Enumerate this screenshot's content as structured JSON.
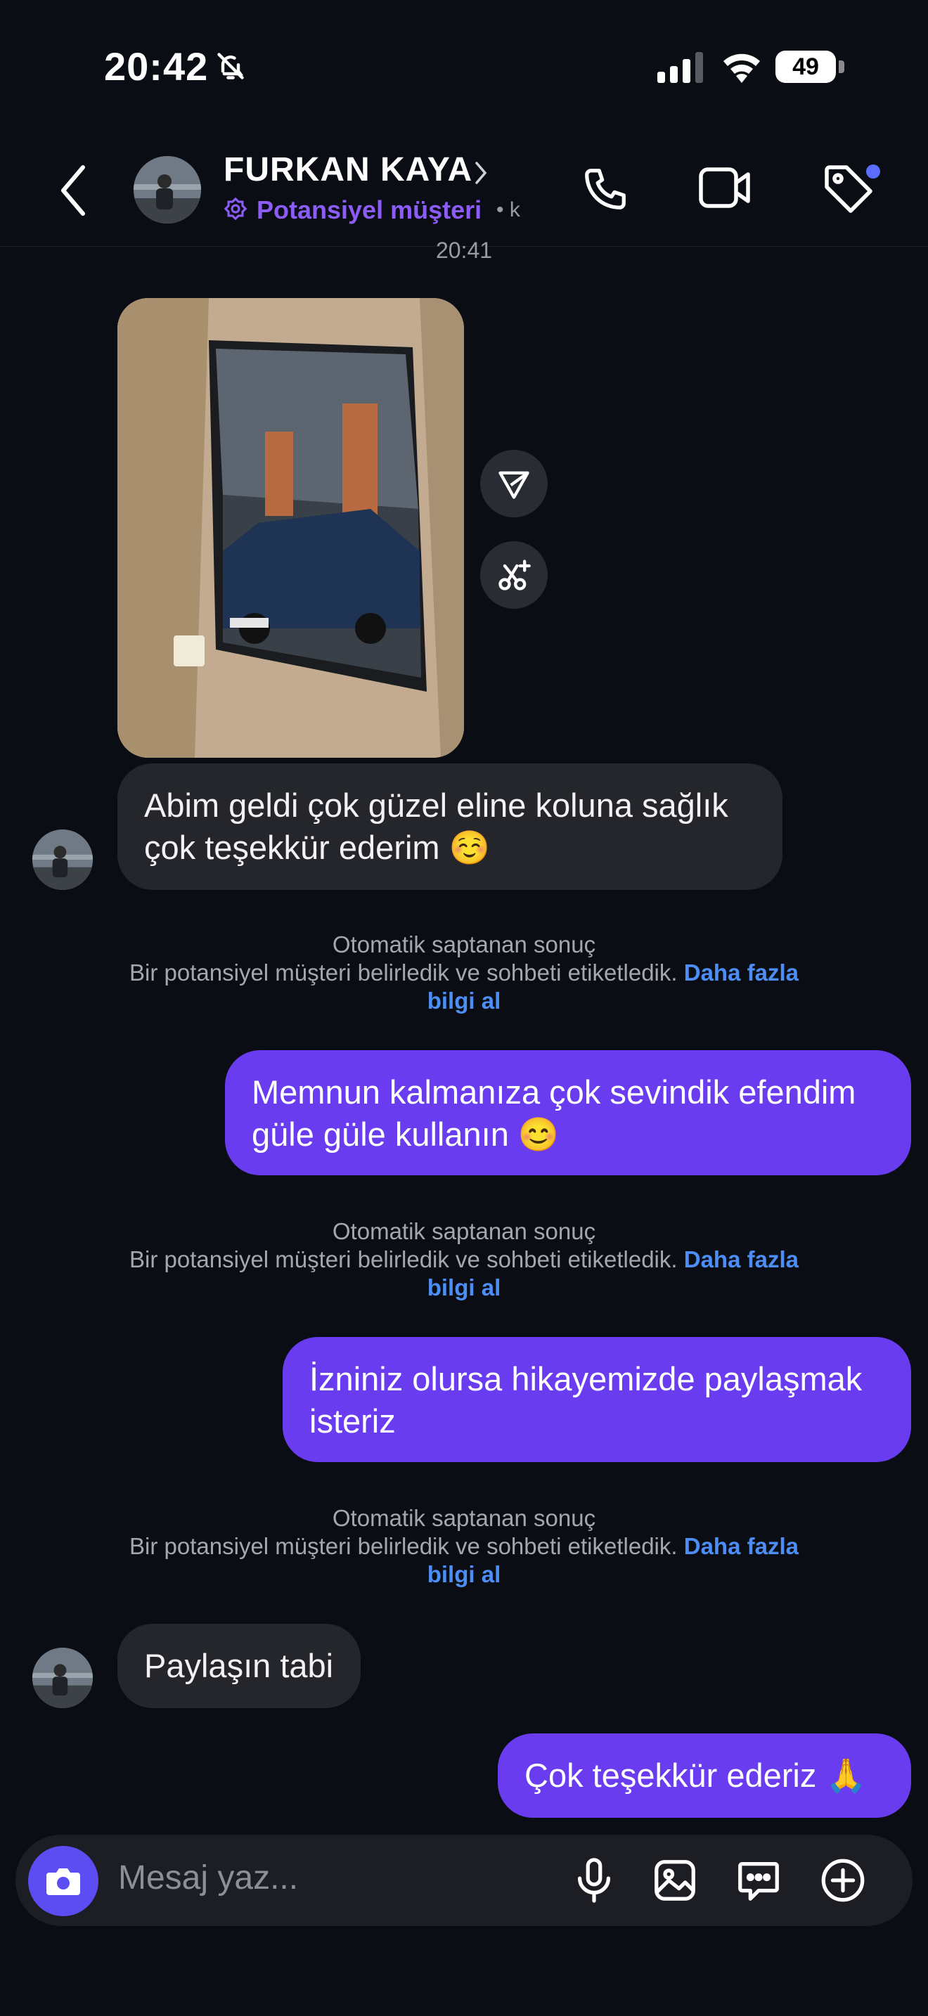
{
  "status_bar": {
    "time": "20:42",
    "battery": "49"
  },
  "header": {
    "name": "FURKAN KAYA",
    "tag": "Potansiyel müşteri",
    "more": "• k"
  },
  "time_separator": "20:41",
  "messages": [
    {
      "text": "Abim geldi çok güzel eline koluna sağlık çok teşekkür ederim ☺️"
    },
    {
      "text": "Memnun kalmanıza çok sevindik efendim güle güle kullanın 😊"
    },
    {
      "text": "İzniniz olursa hikayemizde paylaşmak isteriz"
    },
    {
      "text": "Paylaşın tabi"
    },
    {
      "text": "Çok teşekkür ederiz 🙏"
    }
  ],
  "system_notice": {
    "title": "Otomatik saptanan sonuç",
    "body": "Bir potansiyel müşteri belirledik ve sohbeti etiketledik.",
    "link_part1": "Daha fazla",
    "link_part2": "bilgi al"
  },
  "composer": {
    "placeholder": "Mesaj yaz..."
  },
  "colors": {
    "accent": "#6a3cf0",
    "tag": "#8b5cf6",
    "link": "#4c8ef5"
  }
}
